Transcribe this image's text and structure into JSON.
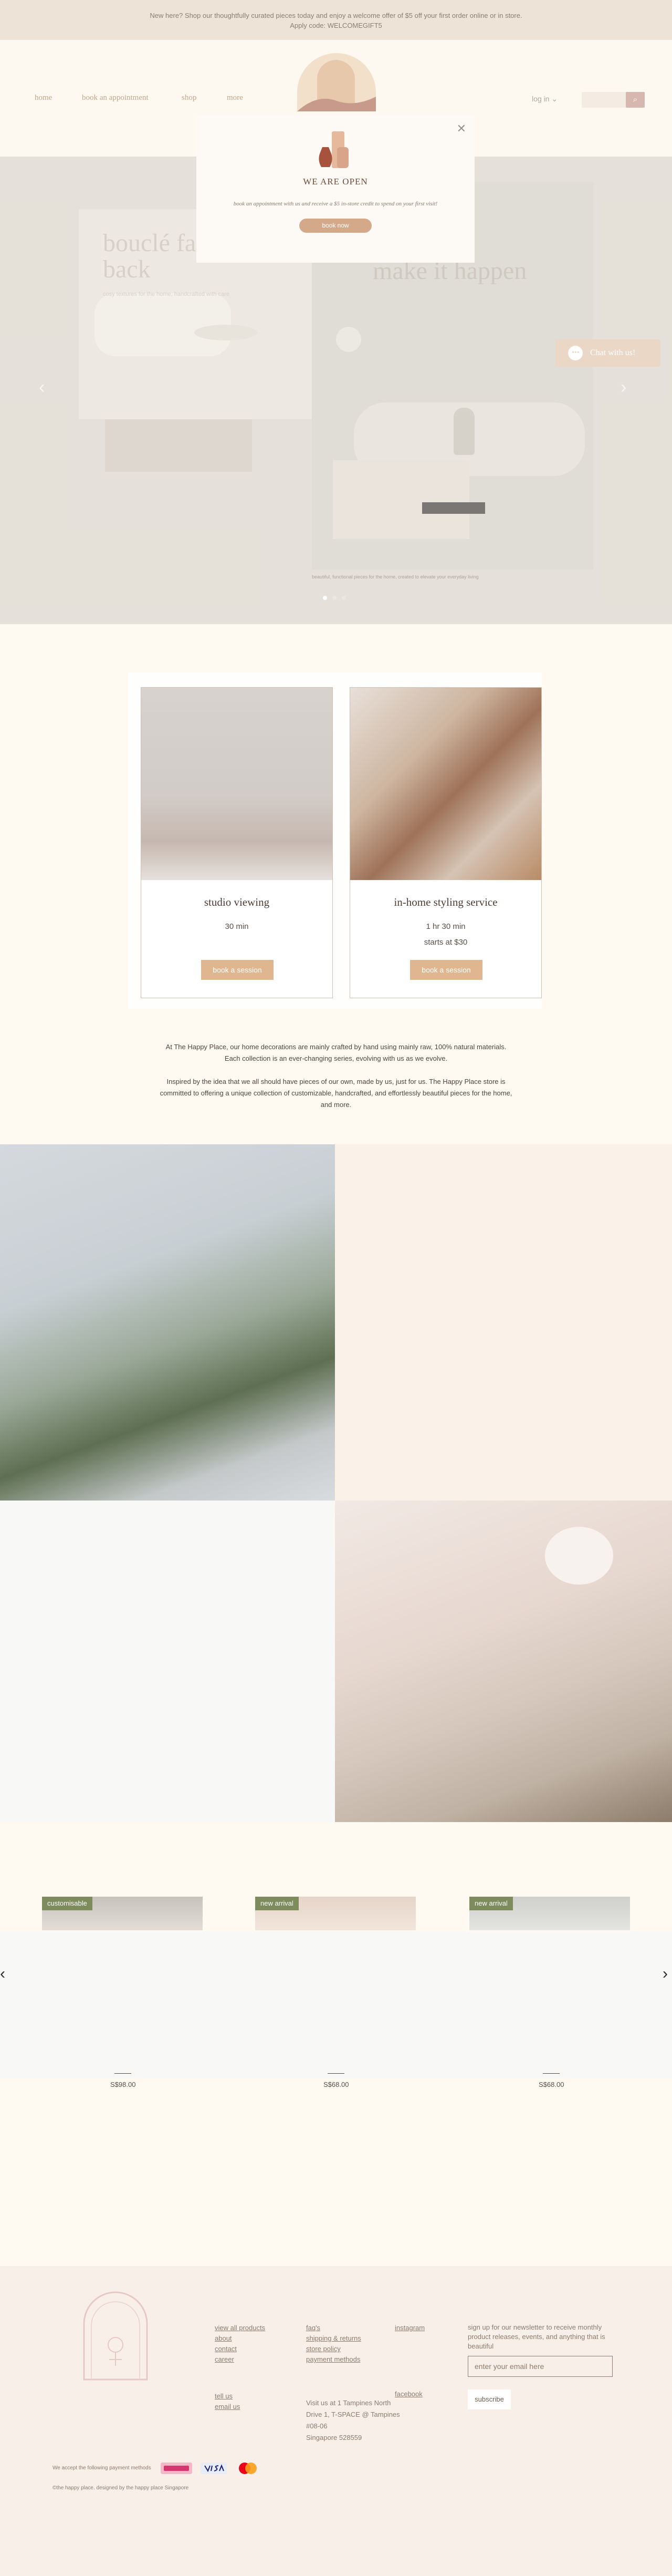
{
  "announcement": {
    "line1": "New here? Shop our thoughtfully curated pieces today and enjoy a welcome offer of $5 off your first order online or in store.",
    "line2": "Apply code: WELCOMEGIFT5"
  },
  "nav": {
    "home": "home",
    "book": "book an appointment",
    "shop": "shop",
    "more": "more",
    "signin": "log in"
  },
  "hero": {
    "left_heading_1": "bouclé fa",
    "left_heading_2": "back",
    "left_sub": "cosy textures for the home, handcrafted with care",
    "right_heading": "make it happen",
    "caption": "beautiful, functional pieces for the home, created to elevate your everyday living",
    "slide_count": 3,
    "active_slide": 1
  },
  "popup": {
    "title": "WE ARE OPEN",
    "text": "book an appointment with us and receive a $5 in-store credit to spend on your first visit!",
    "button": "book now"
  },
  "chat": {
    "label": "Chat with us!"
  },
  "services": [
    {
      "title": "studio viewing",
      "duration": "30 min",
      "price": "",
      "button": "book a session"
    },
    {
      "title": "in-home styling service",
      "duration": "1 hr 30 min",
      "price": "starts at $30",
      "button": "book a session"
    }
  ],
  "about": {
    "p1": "At The Happy Place, our home decorations are mainly crafted by hand using mainly raw, 100% natural materials. Each collection is an ever-changing series, evolving with us as we evolve.",
    "p2": "Inspired by the idea that we all should have pieces of our own, made by us, just for us. The Happy Place store is committed to offering a unique collection of customizable, handcrafted, and effortlessly beautiful pieces for the home, and more."
  },
  "products": [
    {
      "badge": "customisable",
      "price": "S$98.00"
    },
    {
      "badge": "new arrival",
      "price": "S$68.00"
    },
    {
      "badge": "new arrival",
      "price": "S$68.00"
    }
  ],
  "footer": {
    "links_col1": [
      "view all products",
      "about",
      "contact",
      "career"
    ],
    "links_col1b": [
      "tell us",
      "email us"
    ],
    "links_col2": [
      "faq's",
      "shipping & returns",
      "store policy",
      "payment methods"
    ],
    "address": [
      "Visit us at 1 Tampines North",
      "Drive 1, T-SPACE @ Tampines",
      "#08-06",
      "Singapore 528559"
    ],
    "social": [
      "instagram",
      "facebook"
    ],
    "newsletter_text": "sign up for our newsletter to receive monthly product releases, events, and anything that is beautiful",
    "email_placeholder": "enter your email here",
    "subscribe": "subscribe",
    "payments_text": "We accept the following payment methods",
    "copyright": "©the happy place. designed by the happy place Singapore"
  },
  "colors": {
    "accent": "#dfb690",
    "badge": "#7d8b5d",
    "footer_bg": "#f8f0e8"
  }
}
